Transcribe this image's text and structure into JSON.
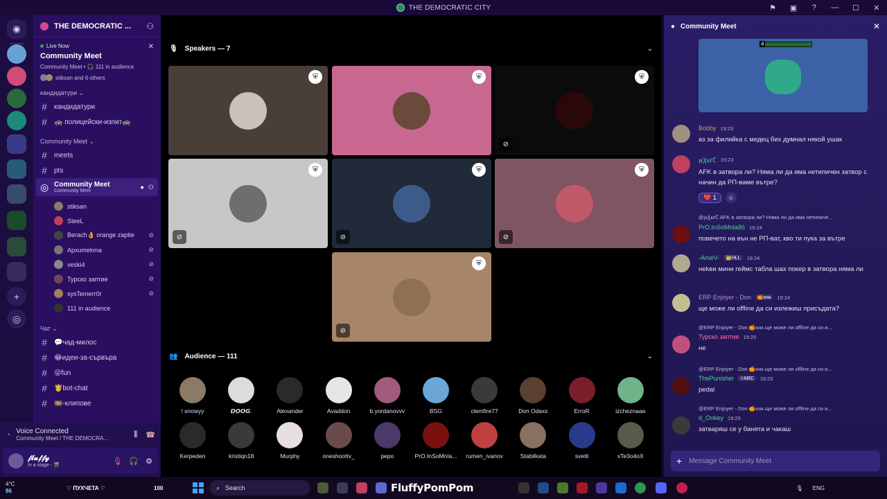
{
  "window": {
    "title": "THE DEMOCRATIC CITY"
  },
  "server": {
    "name": "THE DEMOCRATIC ..."
  },
  "live": {
    "badge": "Live Now",
    "title": "Community Meet",
    "meta": "Community Meet • 🎧 111 in audience",
    "others": "stiksan and 6 others"
  },
  "categories": [
    {
      "label": "кандидатури ⌄"
    },
    {
      "label": "Community Meet ⌄"
    },
    {
      "label": "Чат ⌄"
    }
  ],
  "channels_top": [
    {
      "label": "кандидатури"
    },
    {
      "label": "🚓 полицейски-изпит🚓"
    }
  ],
  "channels_meet": [
    {
      "label": "meets"
    },
    {
      "label": "pts"
    }
  ],
  "stage_channel": {
    "label": "Community Meet",
    "sub": "Community Meet"
  },
  "stage_members": [
    {
      "name": "stiksan",
      "muted": false
    },
    {
      "name": "SteeL",
      "muted": false
    },
    {
      "name": "Berach👌 orange zaptie",
      "muted": true
    },
    {
      "name": "Архumekma",
      "muted": true
    },
    {
      "name": "veski4",
      "muted": true
    },
    {
      "name": "Турско заптие",
      "muted": true
    },
    {
      "name": "sysTemerr0r",
      "muted": true
    },
    {
      "name": "111 in audience",
      "muted": false
    }
  ],
  "channels_chat": [
    {
      "label": "💬чад-милос"
    },
    {
      "label": "😂идеи-за-сървъра"
    },
    {
      "label": "😜fun"
    },
    {
      "label": "🤴bot-chat"
    },
    {
      "label": "🎞️-клипове"
    }
  ],
  "voice": {
    "status": "Voice Connected",
    "location": "Community Meet / THE DEMOCRA..."
  },
  "user": {
    "name": "𝓯𝓵𝓾𝓯𝓯𝔂",
    "status": "In a stage - 🎬"
  },
  "stage": {
    "speakers_header": "Speakers — 7",
    "audience_header": "Audience — 111",
    "speaker_tiles": [
      {
        "bg": "#4a3e39",
        "face": "#c9c2bb",
        "muted": false
      },
      {
        "bg": "#c8678f",
        "face": "#6a4a3a",
        "muted": false
      },
      {
        "bg": "#0b0b0b",
        "face": "#2a0808",
        "muted": true
      },
      {
        "bg": "#c7c7c7",
        "face": "#6e6e6e",
        "muted": true
      },
      {
        "bg": "#202a38",
        "face": "#3c5a8a",
        "muted": true
      },
      {
        "bg": "#7f5463",
        "face": "#c05a6a",
        "muted": true
      },
      {
        "bg": "#a78568",
        "face": "#8f7050",
        "muted": true
      }
    ],
    "audience": [
      {
        "name": "! snowyy",
        "color": "#8a7a66"
      },
      {
        "name": "𝘿𝙊𝙊𝙂.",
        "color": "#dcdcdc"
      },
      {
        "name": "Alexander",
        "color": "#2a2a2a"
      },
      {
        "name": "Avaddon",
        "color": "#e6e6e6"
      },
      {
        "name": "b.yordanovvv",
        "color": "#a05a7a"
      },
      {
        "name": "BSG",
        "color": "#6aa7d6"
      },
      {
        "name": "clemfire77",
        "color": "#3a3a3a"
      },
      {
        "name": "Don Odaxx",
        "color": "#5a4030"
      },
      {
        "name": "ErroR",
        "color": "#7a1f2a"
      },
      {
        "name": "izcheznaaa",
        "color": "#6fb38a"
      },
      {
        "name": "Kerpeden",
        "color": "#2a2a2a"
      },
      {
        "name": "kristiqn18",
        "color": "#3a3a3a"
      },
      {
        "name": "Murphy",
        "color": "#e8e0e0"
      },
      {
        "name": "oneshoottv_",
        "color": "#6a4a4a"
      },
      {
        "name": "pepo",
        "color": "#4a3a6a"
      },
      {
        "name": "PrO.InSoMnIa...",
        "color": "#7a1010"
      },
      {
        "name": "rumen_ivanov",
        "color": "#c04040"
      },
      {
        "name": "Stabilkata",
        "color": "#8a7060"
      },
      {
        "name": "svetli",
        "color": "#2a3a8a"
      },
      {
        "name": "xTe3o4oX",
        "color": "#5a5a4a"
      }
    ]
  },
  "chat": {
    "title": "Community Meet",
    "composer_placeholder": "Message Community Meet",
    "messages": [
      {
        "author": "Bobby",
        "color": "#c0a070",
        "time": "19:23",
        "text": "аз за филийка с медец бих думнал някой ушак",
        "avatar": "#a09080"
      },
      {
        "author": "ꞁꬲꞳꬲꭉꞆ",
        "color": "#48d597",
        "time": "19:23",
        "text": "AFK в затвора ли? Няма ли да има нетипичен затвор с начин да РП-ваме вътре?",
        "avatar": "#c04060",
        "reaction": "❤️ 1"
      },
      {
        "reply": "@ꞁꬲꞳꬲꭉꞆ AFK в затвора ли? Няма ли да има нетипиче...",
        "author": "PrO.InSoMnIa86",
        "color": "#48d597",
        "time": "19:24",
        "text": "повечето на вън не РП-ват, кво ти пука за вътре",
        "avatar": "#6a1010"
      },
      {
        "author": "-AmeV-",
        "color": "#48d597",
        "tag": "👑HLL",
        "time": "19:24",
        "text": "неkви мини геймс табла шах покер в затвора няма ли",
        "avatar": "#b0a890"
      },
      {
        "author": "ERP Enjoyer - Don",
        "color": "#b48fe0",
        "tag": "🍊ᴋᴎᴀ",
        "time": "19:24",
        "text": "ще може ли offline да си излежиш присъдата?",
        "avatar": "#c0c090"
      },
      {
        "reply": "@ERP Enjoyer - Don 🍊ᴋᴎᴀ ще може ли offline да си и...",
        "author": "Турско заптие",
        "color": "#ff6fb0",
        "time": "19:25",
        "text": "не",
        "avatar": "#c05080"
      },
      {
        "reply": "@ERP Enjoyer - Don 🍊ᴋᴎᴀ ще може ли offline да си и...",
        "author": "ThePunisher",
        "color": "#48d597",
        "tag": "⚡ARC",
        "time": "19:25",
        "text": "pedal",
        "avatar": "#501010"
      },
      {
        "reply": "@ERP Enjoyer - Don 🍊ᴋᴎᴀ ще може ли offline да си и...",
        "author": "d_Onkey",
        "color": "#48d597",
        "time": "19:25",
        "text": "затваряш се у банята и чакаш",
        "avatar": "#3a3a3a"
      }
    ]
  },
  "taskbar": {
    "temp": "4°C",
    "weather_num": "86",
    "label_mid": "♡ ПУХЧЕТА ♡",
    "label_num": "100",
    "search": "Search",
    "brand": "FluffyPomPom",
    "lang": "ENG"
  }
}
